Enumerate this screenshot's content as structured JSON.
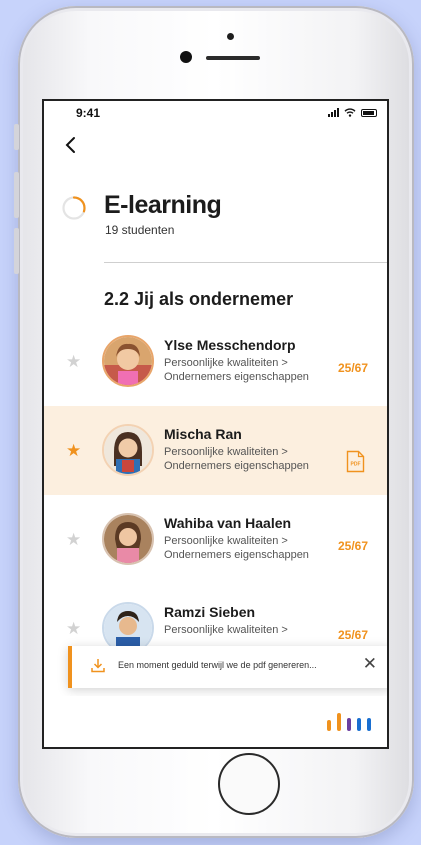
{
  "status_bar": {
    "time": "9:41"
  },
  "header": {
    "title": "E-learning",
    "subtitle": "19 studenten",
    "progress_fraction": 0.3
  },
  "section_title": "2.2 Jij als ondernemer",
  "students": [
    {
      "name": "Ylse Messchendorp",
      "path_line1": "Persoonlijke kwaliteiten >",
      "path_line2": "Ondernemers eigenschappen",
      "score": "25/67",
      "starred": false,
      "highlighted": false,
      "attachment_icon": ""
    },
    {
      "name": "Mischa Ran",
      "path_line1": "Persoonlijke kwaliteiten >",
      "path_line2": "Ondernemers eigenschappen",
      "score": "",
      "starred": true,
      "highlighted": true,
      "attachment_icon": "pdf-file-icon"
    },
    {
      "name": "Wahiba van Haalen",
      "path_line1": "Persoonlijke kwaliteiten >",
      "path_line2": "Ondernemers eigenschappen",
      "score": "25/67",
      "starred": false,
      "highlighted": false,
      "attachment_icon": ""
    },
    {
      "name": "Ramzi Sieben",
      "path_line1": "Persoonlijke kwaliteiten >",
      "path_line2": "",
      "score": "25/67",
      "starred": false,
      "highlighted": false,
      "attachment_icon": ""
    }
  ],
  "toast": {
    "message": "Een moment geduld terwijl we de pdf genereren...",
    "icon": "download-icon",
    "close_icon": "close-icon"
  },
  "pdf_icon_label": "PDF",
  "colors": {
    "accent": "#f0921e",
    "highlight_row": "#fcefdf",
    "logo_orange": "#f0921e",
    "logo_purple": "#6b3fa0",
    "logo_blue": "#1a6fd1"
  },
  "icons": {
    "back": "chevron-left-icon",
    "star": "star-icon",
    "progress": "progress-ring-icon",
    "signal": "signal-icon",
    "wifi": "wifi-icon",
    "battery": "battery-icon",
    "logo": "brand-logo"
  }
}
